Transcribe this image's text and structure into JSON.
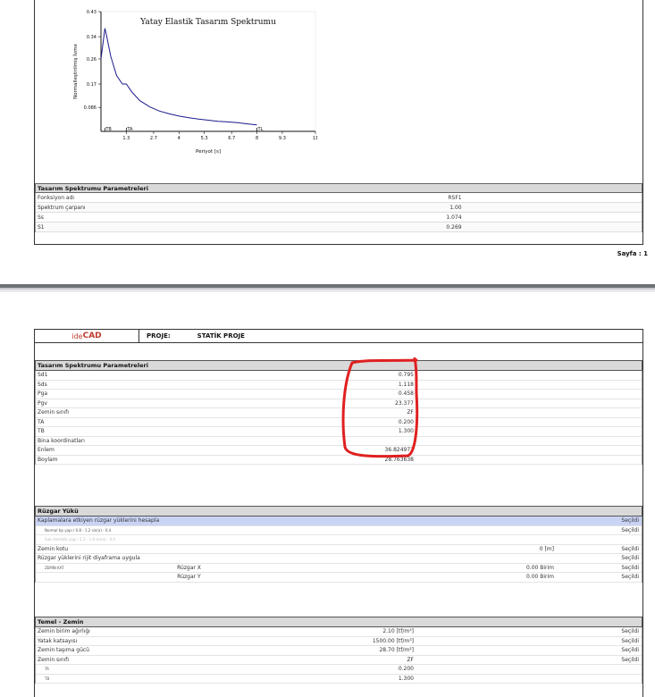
{
  "page1": {
    "chart_data": {
      "type": "line",
      "title": "Yatay Elastik Tasarım Spektrumu",
      "xlabel": "Periyot [s]",
      "ylabel": "Normalleştirilmiş İvme",
      "x_ticks": [
        "1.3",
        "2.7",
        "4",
        "5.3",
        "6.7",
        "8",
        "9.3",
        "11"
      ],
      "y_ticks": [
        "0.43",
        "0.34",
        "0.26",
        "0.17",
        "0.086"
      ],
      "xlim": [
        0,
        11
      ],
      "ylim": [
        0,
        0.43
      ],
      "markers": [
        "TB",
        "TA",
        "TL"
      ],
      "series": [
        {
          "x": [
            0,
            0.2,
            0.3,
            0.5,
            0.8,
            1.1,
            1.3,
            1.6,
            2.0,
            2.5,
            3.0,
            3.5,
            4.0,
            4.5,
            5.0,
            5.5,
            6.0,
            6.5,
            7.0,
            7.5,
            8.0
          ],
          "y": [
            0.26,
            0.37,
            0.34,
            0.27,
            0.2,
            0.17,
            0.17,
            0.14,
            0.11,
            0.088,
            0.073,
            0.063,
            0.055,
            0.049,
            0.044,
            0.04,
            0.036,
            0.034,
            0.031,
            0.027,
            0.023
          ]
        }
      ]
    },
    "params_header": "Tasarım Spektrumu Parametreleri",
    "params": [
      {
        "label": "Fonksiyon adı",
        "value": "RSF1"
      },
      {
        "label": "Spektrum çarpanı",
        "value": "1.00"
      },
      {
        "label": "Ss",
        "value": "1.074"
      },
      {
        "label": "S1",
        "value": "0.269"
      }
    ],
    "page_label": "Sayfa : 1"
  },
  "page2": {
    "logo_ide": "ide",
    "logo_cad": "CAD",
    "proje_label": "PROJE:",
    "proje_name": "STATİK PROJE",
    "spectrum_header": "Tasarım Spektrumu Parametreleri",
    "spectrum": [
      {
        "label": "Sd1",
        "value": "0.795"
      },
      {
        "label": "Sds",
        "value": "1.118"
      },
      {
        "label": "Pga",
        "value": "0.458"
      },
      {
        "label": "Pgv",
        "value": "23.377"
      },
      {
        "label": "Zemin sınıfı",
        "value": "ZF"
      },
      {
        "label": "TA",
        "value": "0.200"
      },
      {
        "label": "TB",
        "value": "1.300"
      },
      {
        "label": "Bina koordinatları",
        "value": ""
      },
      {
        "label": "Enlem",
        "value": "36.824972"
      },
      {
        "label": "Boylam",
        "value": "28.763638"
      }
    ],
    "wind_header": "Rüzgar Yükü",
    "wind": {
      "row1_label": "Kaplamalara etkiyen rüzgar yüklerini hesapla",
      "row1_status": "Seçildi",
      "row2_label": "Normal tip yapı / 0.8 - 1.2 sin(a) - 0.4",
      "row2_status": "Seçildi",
      "row3_label": "Sulu temizlik yapı / 1.2 - 1.6 sin(a) - 0.4",
      "zemin_kotu_label": "Zemin kotu",
      "zemin_kotu_value": "0 [m]",
      "zemin_kotu_status": "Seçildi",
      "rijit_label": "Rüzgar yüklerini rijit diyaframa uygula",
      "rijit_status": "Seçildi",
      "kat_label": "ZEMİN KAT",
      "rx_label": "Rüzgar X",
      "rx_value": "0.00 Birim",
      "rx_status": "Seçildi",
      "ry_label": "Rüzgar Y",
      "ry_value": "0.00 Birim",
      "ry_status": "Seçildi"
    },
    "ground_header": "Temel - Zemin",
    "ground": [
      {
        "label": "Zemin birim ağırlığı",
        "value": "2.10 [tf/m³]",
        "status": "Seçildi"
      },
      {
        "label": "Yatak katsayısı",
        "value": "1500.00 [tf/m³]",
        "status": "Seçildi"
      },
      {
        "label": "Zemin taşıma gücü",
        "value": "28.70 [tf/m²]",
        "status": "Seçildi"
      },
      {
        "label": "Zemin sınıfı",
        "value": "ZF",
        "status": "Seçildi"
      },
      {
        "label": "TA",
        "value": "0.200",
        "status": ""
      },
      {
        "label": "TB",
        "value": "1.300",
        "status": ""
      }
    ]
  }
}
